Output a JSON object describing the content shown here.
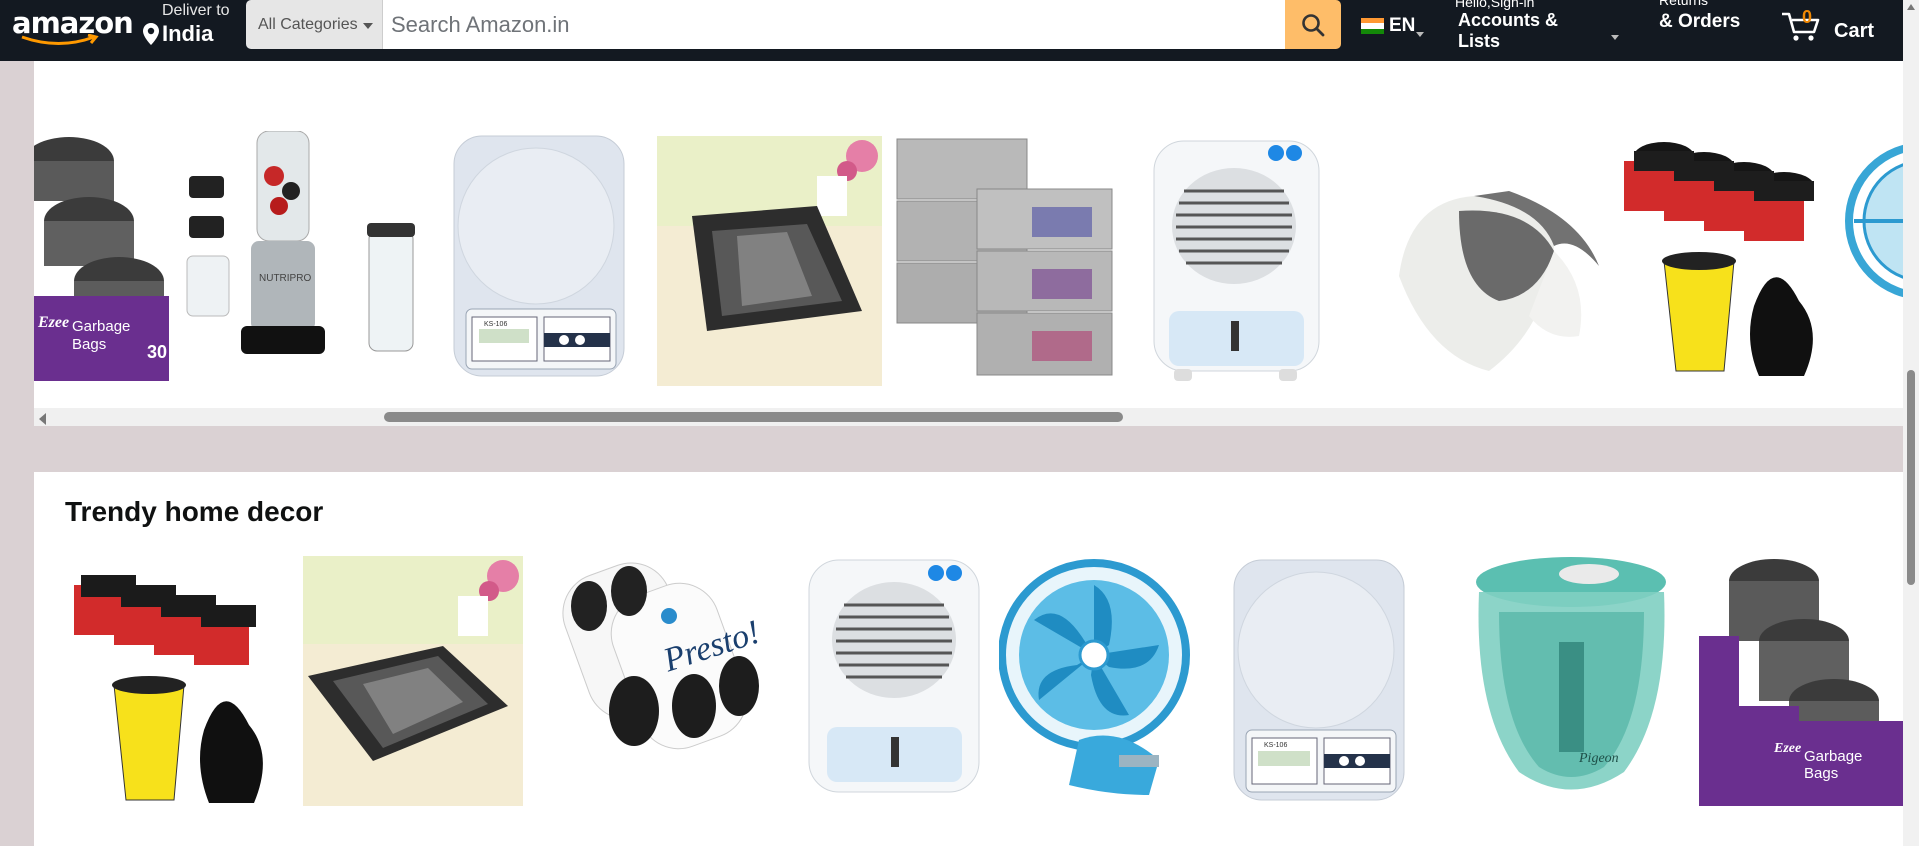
{
  "navbar": {
    "logo_text": "amazon",
    "deliver_label": "Deliver to",
    "deliver_location": "India",
    "search_category": "All Categories",
    "search_placeholder": "Search Amazon.in",
    "language": "EN",
    "account_hello": "Hello,Sign-in",
    "account_main": "Accounts & Lists",
    "returns_label": "Returns",
    "returns_main": "& Orders",
    "cart_count": "0",
    "cart_label": "Cart",
    "colors": {
      "bg": "#131921",
      "search_button": "#febd69",
      "cart_count": "#f08804"
    }
  },
  "top_row": {
    "products": [
      {
        "name": "garbage-bags-ezee",
        "label": "Garbage Bags"
      },
      {
        "name": "nutripro-blender",
        "label": "NUTRIPRO"
      },
      {
        "name": "kitchen-scale",
        "label": "KS-106"
      },
      {
        "name": "door-mat",
        "label": ""
      },
      {
        "name": "storage-organizer",
        "label": ""
      },
      {
        "name": "air-cooler",
        "label": ""
      },
      {
        "name": "pillow",
        "label": ""
      },
      {
        "name": "garbage-bags-shalimar",
        "label": ""
      },
      {
        "name": "clip-fan",
        "label": ""
      }
    ]
  },
  "trendy": {
    "title": "Trendy home decor",
    "products": [
      {
        "name": "garbage-bags-shalimar",
        "label": ""
      },
      {
        "name": "door-mat",
        "label": ""
      },
      {
        "name": "presto-garbage-bags",
        "label": "Presto!"
      },
      {
        "name": "air-cooler",
        "label": ""
      },
      {
        "name": "clip-fan",
        "label": ""
      },
      {
        "name": "kitchen-scale",
        "label": "KS-106"
      },
      {
        "name": "vegetable-chopper",
        "label": "Pigeon"
      },
      {
        "name": "garbage-bags-ezee",
        "label": "Garbage Bags"
      }
    ]
  }
}
